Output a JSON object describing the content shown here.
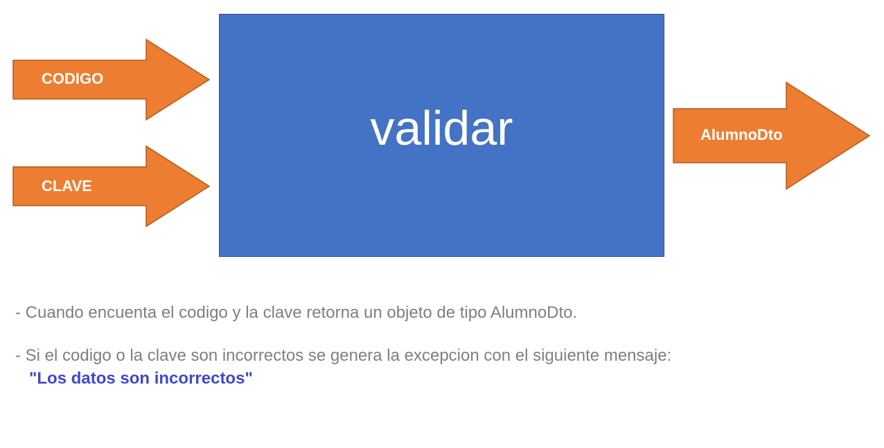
{
  "diagram": {
    "inputs": [
      {
        "label": "CODIGO"
      },
      {
        "label": "CLAVE"
      }
    ],
    "process": {
      "label": "validar"
    },
    "output": {
      "label": "AlumnoDto"
    },
    "colors": {
      "arrow_fill": "#ed7d31",
      "arrow_stroke": "#ae5a21",
      "box_fill": "#4472c4",
      "box_stroke": "#2f528f"
    }
  },
  "notes": {
    "line1": "- Cuando encuenta el codigo y la clave retorna un objeto de tipo AlumnoDto.",
    "line2": "- Si el codigo o la clave son incorrectos se genera la excepcion con el siguiente mensaje:",
    "message": "\"Los datos son incorrectos\"",
    "colors": {
      "text": "#7f7f7f",
      "message": "#3f48cc"
    }
  }
}
